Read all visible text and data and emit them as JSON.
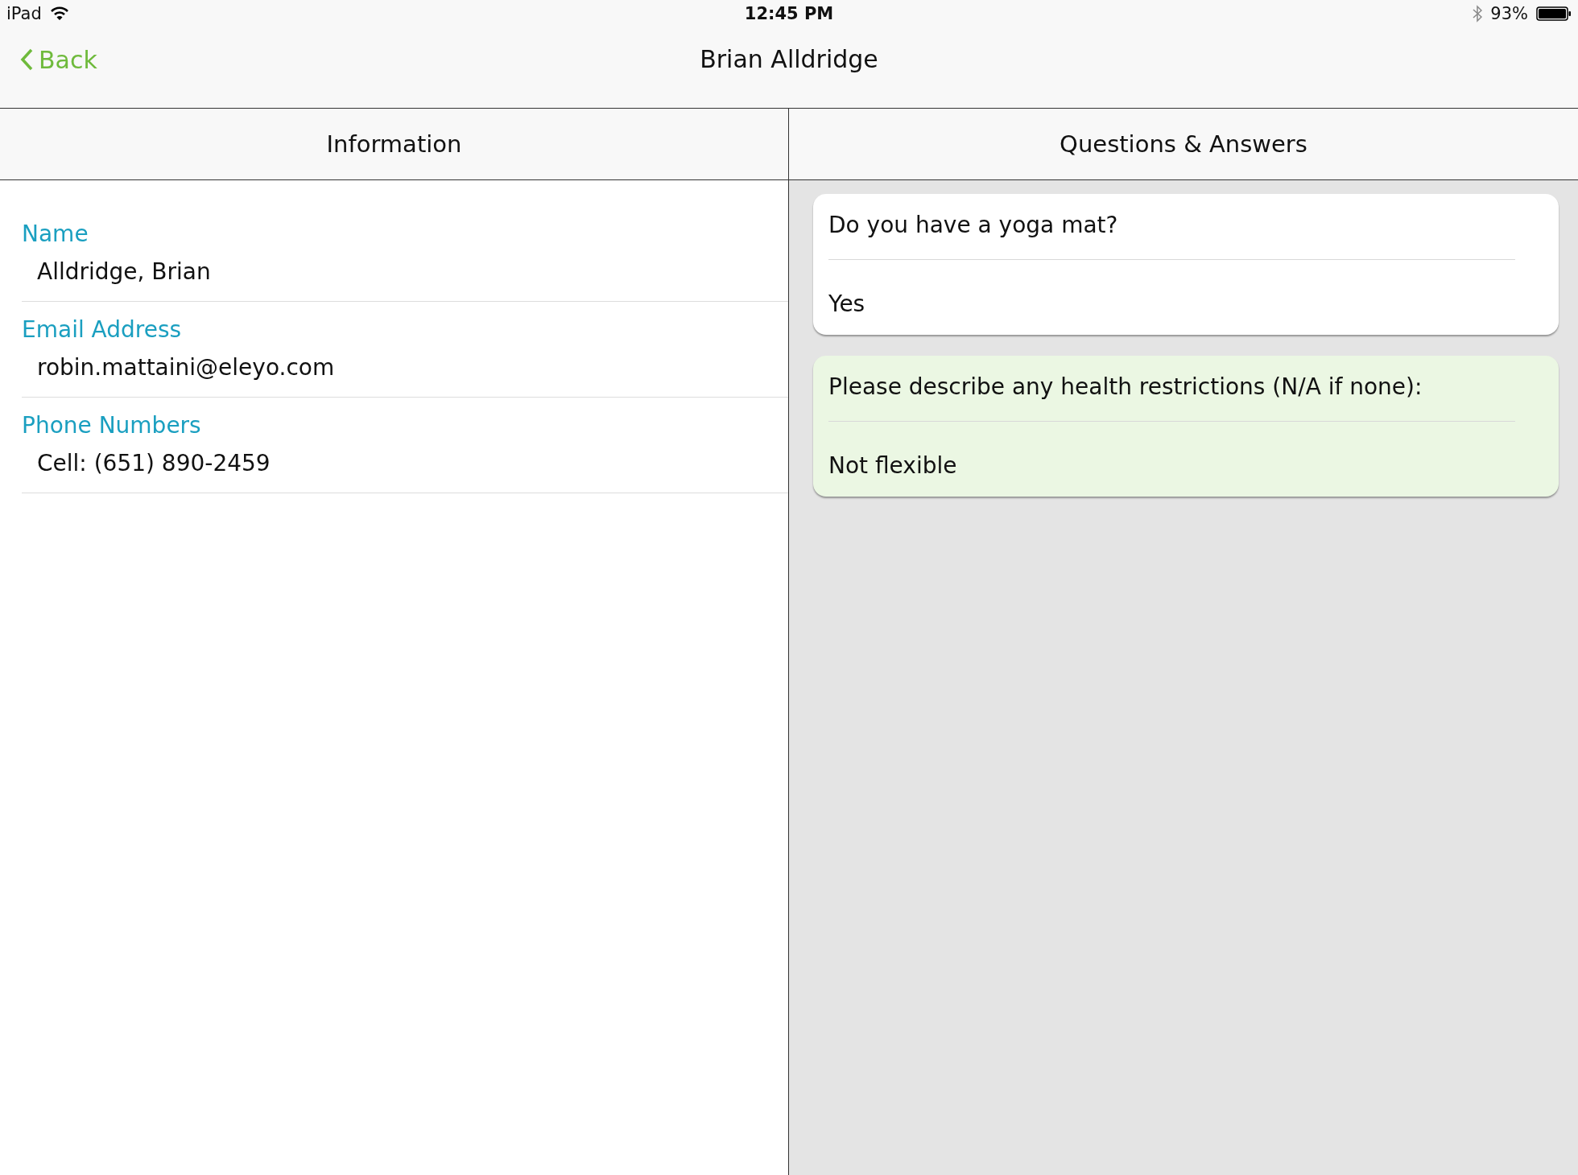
{
  "status_bar": {
    "device": "iPad",
    "time": "12:45 PM",
    "battery_percent": "93%"
  },
  "nav_bar": {
    "back_label": "Back",
    "title": "Brian Alldridge"
  },
  "panels": [
    {
      "heading": "Information"
    },
    {
      "heading": "Questions & Answers"
    }
  ],
  "information": [
    {
      "label": "Name",
      "value": "Alldridge, Brian"
    },
    {
      "label": "Email Address",
      "value": "robin.mattaini@eleyo.com"
    },
    {
      "label": "Phone Numbers",
      "value": "Cell: (651) 890-2459"
    }
  ],
  "questions": [
    {
      "question": "Do you have a yoga mat?",
      "answer": "Yes",
      "color": "#ffffff"
    },
    {
      "question": "Please describe any health restrictions (N/A if none):",
      "answer": "Not flexible",
      "color": "#ebf7e3"
    }
  ]
}
